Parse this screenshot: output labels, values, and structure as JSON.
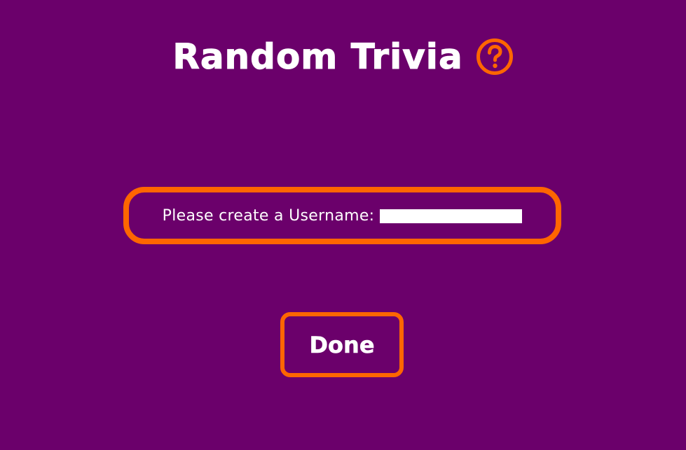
{
  "app": {
    "title": "Random Trivia",
    "help_icon": "question-circle-icon"
  },
  "form": {
    "username_label": "Please create a Username:",
    "username_value": "",
    "done_label": "Done"
  },
  "colors": {
    "background": "#6b006b",
    "accent": "#ff6600",
    "text": "#ffffff"
  }
}
